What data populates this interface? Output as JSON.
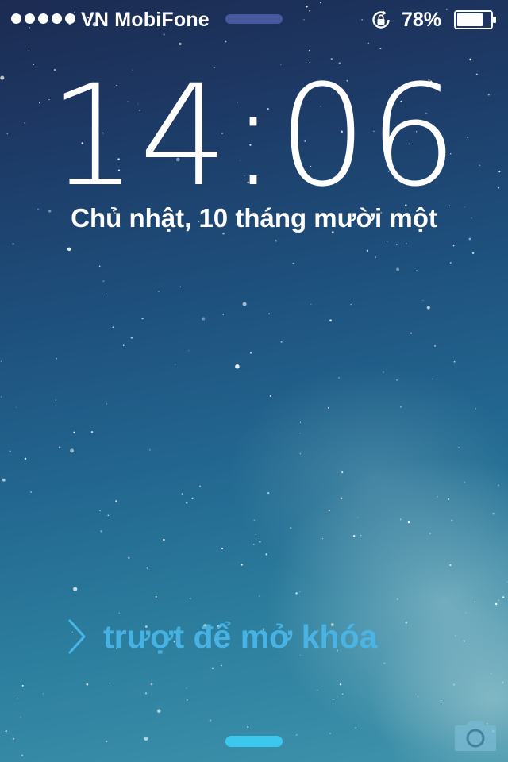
{
  "status_bar": {
    "signal_bars": 5,
    "carrier": "VN MobiFone",
    "battery_percent": "78%",
    "battery_level": 0.78,
    "icons": [
      "signal-dots-icon",
      "rotation-lock-icon",
      "battery-icon"
    ]
  },
  "lock_screen": {
    "time": "14:06",
    "time_hours": "14",
    "time_minutes": "06",
    "date": "Chủ nhật, 10 tháng mười một",
    "slide_to_unlock": "trượt để mở khóa",
    "icons": [
      "chevron-right-icon",
      "camera-icon"
    ]
  },
  "colors": {
    "accent": "#4ab6e8",
    "handle": "#3cc8ee",
    "notification_handle": "#505faa"
  }
}
